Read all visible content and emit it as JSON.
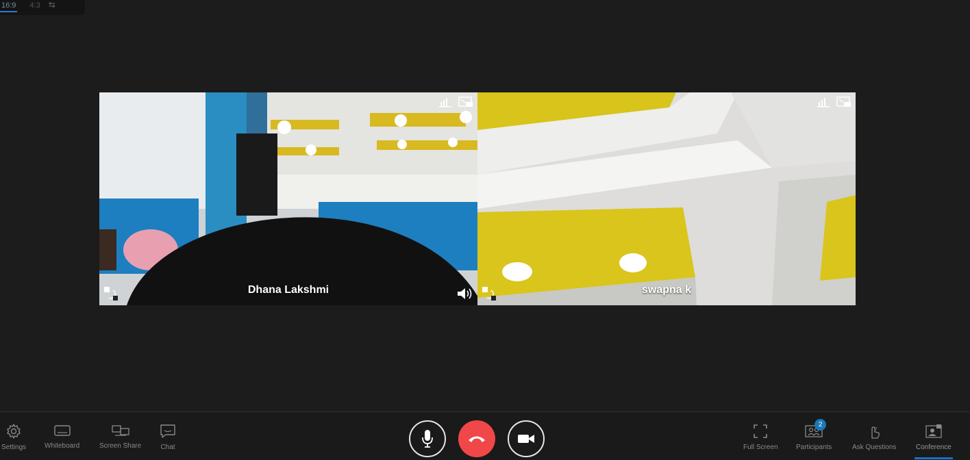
{
  "aspect_ratio": {
    "options": [
      "16:9",
      "4:3"
    ],
    "selected": "16:9"
  },
  "participants_tiles": [
    {
      "name": "Dhana Lakshmi"
    },
    {
      "name": "swapna k"
    }
  ],
  "toolbar": {
    "left": [
      {
        "label": "Settings",
        "icon": "gear-icon"
      },
      {
        "label": "Whiteboard",
        "icon": "whiteboard-icon"
      },
      {
        "label": "Screen Share",
        "icon": "screen-share-icon"
      },
      {
        "label": "Chat",
        "icon": "chat-icon"
      }
    ],
    "center": {
      "mic": "microphone-icon",
      "end_call": "hang-up-icon",
      "camera": "video-camera-icon"
    },
    "right": [
      {
        "label": "Full Screen",
        "icon": "fullscreen-icon"
      },
      {
        "label": "Participants",
        "icon": "participants-icon",
        "badge": "2"
      },
      {
        "label": "Ask Questions",
        "icon": "hand-question-icon"
      },
      {
        "label": "Conference",
        "icon": "conference-icon",
        "active": true
      }
    ]
  },
  "colors": {
    "accent": "#1d6fc4",
    "end_call": "#f04848",
    "badge": "#1a78b8"
  }
}
